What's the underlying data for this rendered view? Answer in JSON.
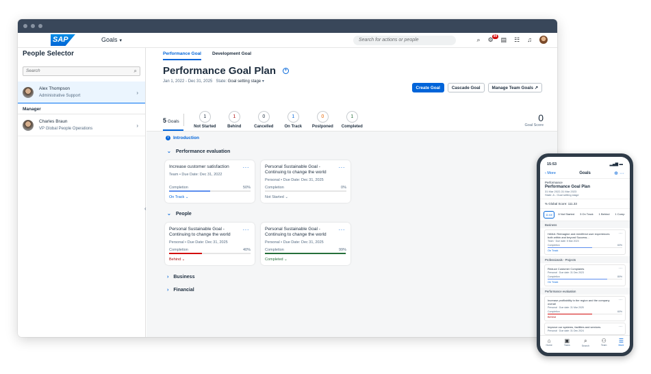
{
  "shell": {
    "logo": "SAP",
    "app_title": "Goals",
    "search_placeholder": "Search for actions or people",
    "notification_count": "99"
  },
  "sidebar": {
    "title": "People Selector",
    "search_placeholder": "Search",
    "selected_person": {
      "name": "Alex Thompson",
      "role": "Administrative Support"
    },
    "manager_label": "Manager",
    "manager": {
      "name": "Charles Braun",
      "role": "VP Global People Operations"
    }
  },
  "main": {
    "tabs": [
      {
        "label": "Performance Goal"
      },
      {
        "label": "Development Goal"
      }
    ],
    "title": "Performance Goal Plan",
    "date_range": "Jan 1, 2022 - Dec 31, 2025",
    "state_label": "State:",
    "state_value": "Goal setting stage",
    "actions": {
      "create": "Create Goal",
      "cascade": "Cascade Goal",
      "manage": "Manage Team Goals"
    },
    "goals_total_num": "5",
    "goals_total_label": "Goals",
    "stats": [
      {
        "value": "1",
        "label": "Not Started",
        "color": "#1d2d3e"
      },
      {
        "value": "1",
        "label": "Behind",
        "color": "#aa0808"
      },
      {
        "value": "0",
        "label": "Cancelled",
        "color": "#1d2d3e"
      },
      {
        "value": "1",
        "label": "On Track",
        "color": "#0064d9"
      },
      {
        "value": "0",
        "label": "Postponed",
        "color": "#e76500"
      },
      {
        "value": "1",
        "label": "Completed",
        "color": "#256f3a"
      }
    ],
    "goal_score_value": "0",
    "goal_score_label": "Goal Score",
    "intro_label": "Introduction",
    "completion_label": "Completion",
    "sections": [
      {
        "title": "Performance evaluation",
        "cards": [
          {
            "title": "Increase customer satisfaction",
            "sub": "Team • Due Date: Dec 31, 2022",
            "percent": "50%",
            "fill": 50,
            "color": "#5b8def",
            "status": "On Track",
            "status_color": "#0064d9"
          },
          {
            "title": "Personal Sustainable Goal - Continuing to change the world",
            "sub": "Personal • Due Date: Dec 31, 2025",
            "percent": "0%",
            "fill": 0,
            "color": "#5b8def",
            "status": "Not Started",
            "status_color": "#556b82"
          }
        ]
      },
      {
        "title": "People",
        "cards": [
          {
            "title": "Personal Sustainable Goal - Continuing to change the world",
            "sub": "Personal • Due Date: Dec 31, 2025",
            "percent": "40%",
            "fill": 40,
            "color": "#d20a0a",
            "status": "Behind",
            "status_color": "#aa0808"
          },
          {
            "title": "Personal Sustainable Goal - Continuing to change the world",
            "sub": "Personal • Due Date: Dec 31, 2025",
            "percent": "99%",
            "fill": 99,
            "color": "#256f3a",
            "status": "Completed",
            "status_color": "#256f3a"
          }
        ]
      }
    ],
    "collapsed_sections": [
      "Business",
      "Financial"
    ]
  },
  "phone": {
    "time": "15:53",
    "back": "More",
    "title": "Goals",
    "head_small": "Performance",
    "head_big": "Performance Goal Plan",
    "head_dates": "31 Mar 2022-31 Mar 2023",
    "head_state": "State: A - Goal setting stage",
    "score": "% Global Score: 111.33",
    "chips": [
      "11 All",
      "6 Not Started",
      "3 On Track",
      "1 Behind",
      "1 Comp"
    ],
    "sections": [
      {
        "title": "Business",
        "cards": [
          {
            "title": "HANA: Reimagine and reenllfrect user experiences both within and beyond Success...",
            "sub": "Team · Due date: 5 Mar 2023",
            "pct": "60%",
            "fill": 60,
            "color": "#5b8def",
            "status": "On Track",
            "status_color": "#0064d9"
          }
        ]
      },
      {
        "title": "Professionals - Projects",
        "cards": [
          {
            "title": "Reduce Customer Complaints",
            "sub": "Personal · Due date: 31 Dec 2023",
            "pct": "80%",
            "fill": 80,
            "color": "#5b8def",
            "status": "On Track",
            "status_color": "#0064d9"
          }
        ]
      },
      {
        "title": "Performance evaluation",
        "cards": [
          {
            "title": "Increase profitability in the region and the company overall",
            "sub": "Personal · Due date: 31 Mar 2025",
            "pct": "60%",
            "fill": 60,
            "color": "#d20a0a",
            "status": "Behind",
            "status_color": "#aa0808"
          },
          {
            "title": "Improve our systems, facilities and services.",
            "sub": "Personal · Due date: 31 Dec 2024",
            "pct": "",
            "fill": 0,
            "color": "#5b8def",
            "status": "",
            "status_color": "#556b82"
          }
        ]
      }
    ],
    "tabbar": [
      {
        "icon": "⌂",
        "label": "Home",
        "name": "home-icon"
      },
      {
        "icon": "▣",
        "label": "Tasks",
        "name": "tasks-icon"
      },
      {
        "icon": "⌕",
        "label": "Search",
        "name": "search-icon"
      },
      {
        "icon": "⚇",
        "label": "Team",
        "name": "team-icon"
      },
      {
        "icon": "☰",
        "label": "More",
        "name": "more-icon"
      }
    ]
  }
}
